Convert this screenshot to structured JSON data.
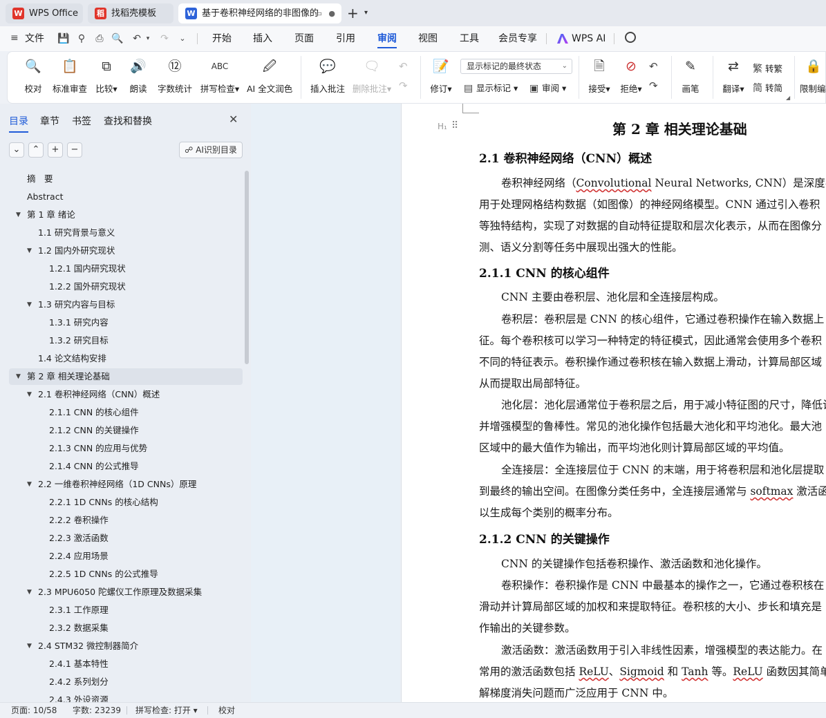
{
  "tabs": [
    {
      "label": "WPS Office",
      "icon": "W"
    },
    {
      "label": "找稻壳模板",
      "icon": "稻"
    },
    {
      "label": "基于卷积神经网络的非图像的",
      "icon": "W"
    }
  ],
  "menu": {
    "file": "文件",
    "items": [
      "开始",
      "插入",
      "页面",
      "引用",
      "审阅",
      "视图",
      "工具",
      "会员专享"
    ],
    "ai": "WPS AI"
  },
  "ribbon": {
    "proofread": "校对",
    "std_review": "标准审查",
    "compare": "比较",
    "read_aloud": "朗读",
    "word_count": "字数统计",
    "spell_check": "拼写检查",
    "ai_polish": "AI 全文润色",
    "insert_comment": "插入批注",
    "delete_comment": "删除批注",
    "revise": "修订",
    "markup_mode": "显示标记的最终状态",
    "show_markup": "显示标记",
    "review_pane": "审阅",
    "accept": "接受",
    "reject": "拒绝",
    "pen": "画笔",
    "translate": "翻译",
    "to_traditional": "转繁",
    "to_simplified": "转简",
    "restrict": "限制编"
  },
  "panel": {
    "tabs": [
      "目录",
      "章节",
      "书签",
      "查找和替换"
    ],
    "ai_toc": "AI识别目录",
    "toc": [
      {
        "label": "摘　要",
        "level": 1
      },
      {
        "label": "Abstract",
        "level": 1
      },
      {
        "label": "第 1 章  绪论",
        "level": 1
      },
      {
        "label": "1.1  研究背景与意义",
        "level": 2
      },
      {
        "label": "1.2  国内外研究现状",
        "level": 2
      },
      {
        "label": "1.2.1 国内研究现状",
        "level": 3
      },
      {
        "label": "1.2.2 国外研究现状",
        "level": 3
      },
      {
        "label": "1.3  研究内容与目标",
        "level": 2
      },
      {
        "label": "1.3.1 研究内容",
        "level": 3
      },
      {
        "label": "1.3.2 研究目标",
        "level": 3
      },
      {
        "label": "1.4  论文结构安排",
        "level": 2
      },
      {
        "label": "第 2 章  相关理论基础",
        "level": 1
      },
      {
        "label": "2.1  卷积神经网络（CNN）概述",
        "level": 2
      },
      {
        "label": "2.1.1 CNN 的核心组件",
        "level": 3
      },
      {
        "label": "2.1.2 CNN 的关键操作",
        "level": 3
      },
      {
        "label": "2.1.3 CNN 的应用与优势",
        "level": 3
      },
      {
        "label": "2.1.4 CNN 的公式推导",
        "level": 3
      },
      {
        "label": "2.2  一维卷积神经网络（1D CNNs）原理",
        "level": 2
      },
      {
        "label": "2.2.1 1D CNNs 的核心结构",
        "level": 3
      },
      {
        "label": "2.2.2  卷积操作",
        "level": 3
      },
      {
        "label": "2.2.3  激活函数",
        "level": 3
      },
      {
        "label": "2.2.4  应用场景",
        "level": 3
      },
      {
        "label": "2.2.5 1D CNNs 的公式推导",
        "level": 3
      },
      {
        "label": "2.3 MPU6050 陀螺仪工作原理及数据采集",
        "level": 2
      },
      {
        "label": "2.3.1  工作原理",
        "level": 3
      },
      {
        "label": "2.3.2  数据采集",
        "level": 3
      },
      {
        "label": "2.4 STM32 微控制器简介",
        "level": 2
      },
      {
        "label": "2.4.1  基本特性",
        "level": 3
      },
      {
        "label": "2.4.2  系列划分",
        "level": 3
      },
      {
        "label": "2.4.3  外设资源",
        "level": 3
      }
    ]
  },
  "doc": {
    "chapter": "第 2 章  相关理论基础",
    "sec21": "2.1  卷积神经网络（CNN）概述",
    "p1": [
      "卷积神经网络（Convolutional Neural Networks, CNN）是深度学习中",
      "用于处理网格结构数据（如图像）的神经网络模型。CNN 通过引入卷积",
      "等独特结构，实现了对数据的自动特征提取和层次化表示，从而在图像分",
      "测、语义分割等任务中展现出强大的性能。"
    ],
    "sec211": "2.1.1 CNN 的核心组件",
    "p2": [
      "CNN 主要由卷积层、池化层和全连接层构成。",
      "卷积层：卷积层是 CNN 的核心组件，它通过卷积操作在输入数据上",
      "征。每个卷积核可以学习一种特定的特征模式，因此通常会使用多个卷积",
      "不同的特征表示。卷积操作通过卷积核在输入数据上滑动，计算局部区域",
      "从而提取出局部特征。",
      "池化层：池化层通常位于卷积层之后，用于减小特征图的尺寸，降低计",
      "并增强模型的鲁棒性。常见的池化操作包括最大池化和平均池化。最大池",
      "区域中的最大值作为输出，而平均池化则计算局部区域的平均值。",
      "全连接层：全连接层位于 CNN 的末端，用于将卷积层和池化层提取",
      "到最终的输出空间。在图像分类任务中，全连接层通常与 softmax 激活函数",
      "以生成每个类别的概率分布。"
    ],
    "sec212": "2.1.2 CNN 的关键操作",
    "p3": [
      "CNN 的关键操作包括卷积操作、激活函数和池化操作。",
      "卷积操作：卷积操作是 CNN 中最基本的操作之一，它通过卷积核在",
      "滑动并计算局部区域的加权和来提取特征。卷积核的大小、步长和填充是",
      "作输出的关键参数。",
      "激活函数：激活函数用于引入非线性因素，增强模型的表达能力。在",
      "常用的激活函数包括 ReLU、Sigmoid 和 Tanh 等。ReLU 函数因其简单有",
      "解梯度消失问题而广泛应用于 CNN 中。"
    ]
  },
  "status": {
    "page": "页面: 10/58",
    "words": "字数: 23239",
    "spell": "拼写检查: 打开",
    "proof": "校对"
  }
}
